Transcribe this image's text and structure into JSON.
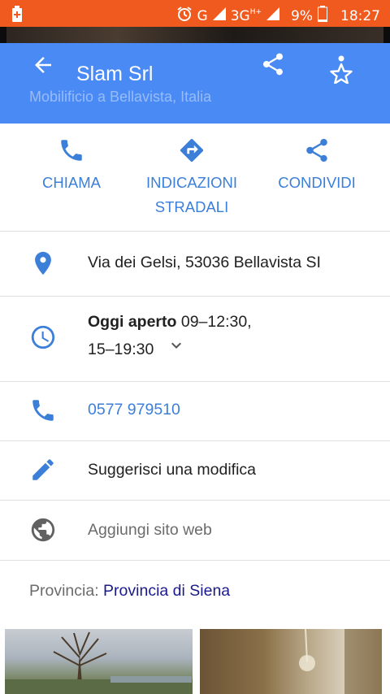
{
  "status_bar": {
    "network_g": "G",
    "network_3g": "3G",
    "network_hplus": "H+",
    "battery": "9%",
    "time": "18:27"
  },
  "header": {
    "title": "Slam Srl",
    "subtitle": "Mobilificio a Bellavista, Italia"
  },
  "actions": [
    {
      "label": "CHIAMA",
      "icon": "phone-icon"
    },
    {
      "label": "INDICAZIONI",
      "label2": "STRADALI",
      "icon": "directions-icon"
    },
    {
      "label": "CONDIVIDI",
      "icon": "share-icon"
    }
  ],
  "details": {
    "address": "Via dei Gelsi, 53036 Bellavista SI",
    "hours_status": "Oggi aperto",
    "hours_part1": "09–12:30,",
    "hours_part2": "15–19:30",
    "phone": "0577 979510",
    "suggest_edit": "Suggerisci una modifica",
    "add_website": "Aggiungi sito web"
  },
  "provincia": {
    "label": "Provincia:",
    "value": "Provincia di Siena"
  },
  "colors": {
    "status_bar": "#f05a1e",
    "app_bar": "#4a8af4",
    "accent": "#3b7fd9",
    "link": "#1a1a8c"
  }
}
